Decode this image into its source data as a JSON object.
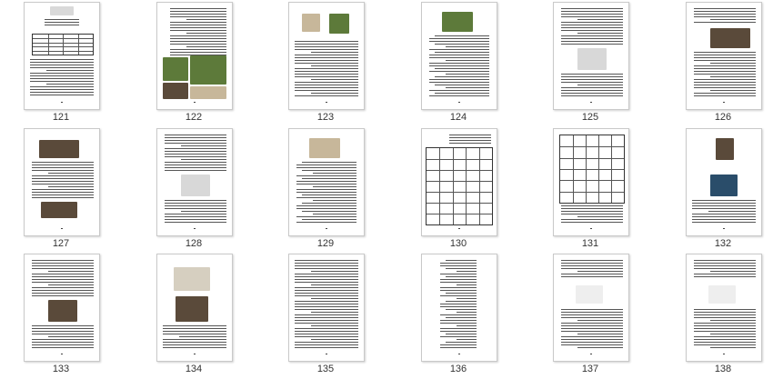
{
  "thumbnails": [
    {
      "page": "121",
      "kind": "title-table"
    },
    {
      "page": "122",
      "kind": "text-images-bottom"
    },
    {
      "page": "123",
      "kind": "images-top-text"
    },
    {
      "page": "124",
      "kind": "image-top-text"
    },
    {
      "page": "125",
      "kind": "text-image-mid"
    },
    {
      "page": "126",
      "kind": "image-mid-text"
    },
    {
      "page": "127",
      "kind": "image-top-bottom"
    },
    {
      "page": "128",
      "kind": "text-image-mid"
    },
    {
      "page": "129",
      "kind": "image-top-text"
    },
    {
      "page": "130",
      "kind": "table"
    },
    {
      "page": "131",
      "kind": "table"
    },
    {
      "page": "132",
      "kind": "images-top-text"
    },
    {
      "page": "133",
      "kind": "text-image-mid"
    },
    {
      "page": "134",
      "kind": "images-top-text"
    },
    {
      "page": "135",
      "kind": "text"
    },
    {
      "page": "136",
      "kind": "list"
    },
    {
      "page": "137",
      "kind": "sketch-text"
    },
    {
      "page": "138",
      "kind": "sketch-text"
    }
  ],
  "colors": {
    "text_line": "#555555",
    "border": "#c9c9c9",
    "photo_dark": "#5a4a3a",
    "photo_green": "#5d7a3a",
    "photo_beige": "#c7b79a",
    "photo_blue": "#2a4d6a"
  }
}
